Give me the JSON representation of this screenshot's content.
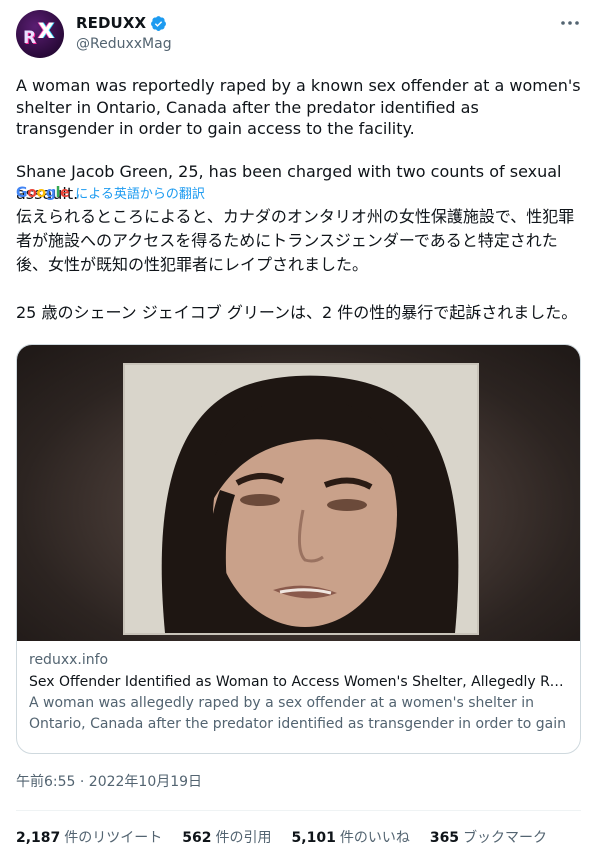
{
  "author": {
    "display_name": "REDUXX",
    "handle": "@ReduxxMag",
    "avatar_text_left": "R",
    "avatar_text_right": "X",
    "verified": true
  },
  "tweet": {
    "text": "A woman was reportedly raped by a known sex offender at a women's shelter in Ontario, Canada after the predator identified as transgender in order to gain access to the facility.\n\nShane Jacob Green, 25, has been charged with two counts of sexual assault.",
    "translation_brand": "Google",
    "translation_label": "による英語からの翻訳",
    "translated_text": "伝えられるところによると、カナダのオンタリオ州の女性保護施設で、性犯罪者が施設へのアクセスを得るためにトランスジェンダーであると特定された後、女性が既知の性犯罪者にレイプされました。\n\n25 歳のシェーン ジェイコブ グリーンは、2 件の性的暴行で起訴されました。"
  },
  "card": {
    "domain": "reduxx.info",
    "title": "Sex Offender Identified as Woman to Access Women's Shelter, Allegedly Raped ...",
    "description": "A woman was allegedly raped by a sex offender at a women's shelter in Ontario, Canada after the predator identified as transgender in order to gain access to th..."
  },
  "timestamp": "午前6:55 · 2022年10月19日",
  "stats": [
    {
      "value": "2,187",
      "label": "件のリツイート"
    },
    {
      "value": "562",
      "label": "件の引用"
    },
    {
      "value": "5,101",
      "label": "件のいいね"
    },
    {
      "value": "365",
      "label": "ブックマーク"
    }
  ],
  "colors": {
    "link": "#1d9bf0",
    "secondary_text": "#536471",
    "primary_text": "#0f1419",
    "border": "#cfd9de"
  },
  "icons": [
    "verified-badge-icon",
    "more-options-icon",
    "google-logo"
  ]
}
